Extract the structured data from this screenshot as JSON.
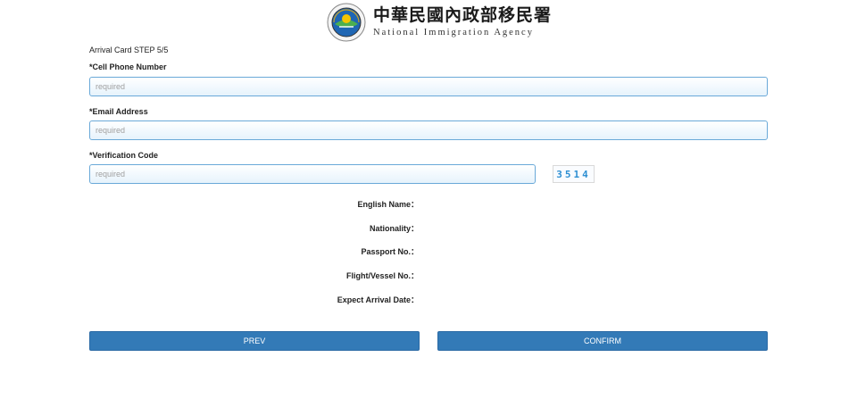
{
  "header": {
    "logo_icon": "national-immigration-agency-seal-icon",
    "title_zh": "中華民國內政部移民署",
    "title_en": "National Immigration Agency"
  },
  "form": {
    "step": "Arrival Card STEP 5/5",
    "phone": {
      "label": "*Cell Phone Number",
      "value": "",
      "placeholder": "required"
    },
    "email": {
      "label": "*Email Address",
      "value": "",
      "placeholder": "required"
    },
    "verification": {
      "label": "*Verification Code",
      "value": "",
      "placeholder": "required"
    },
    "captcha_code": "3514"
  },
  "summary": [
    {
      "label": "English Name：",
      "value": ""
    },
    {
      "label": "Nationality：",
      "value": ""
    },
    {
      "label": "Passport No.：",
      "value": ""
    },
    {
      "label": "Flight/Vessel No.：",
      "value": ""
    },
    {
      "label": "Expect Arrival Date：",
      "value": ""
    }
  ],
  "buttons": {
    "prev": "PREV",
    "confirm": "CONFIRM"
  },
  "colors": {
    "button": "#337ab7",
    "input_border": "#6aa9d8",
    "captcha_text": "#2e8fd2"
  }
}
